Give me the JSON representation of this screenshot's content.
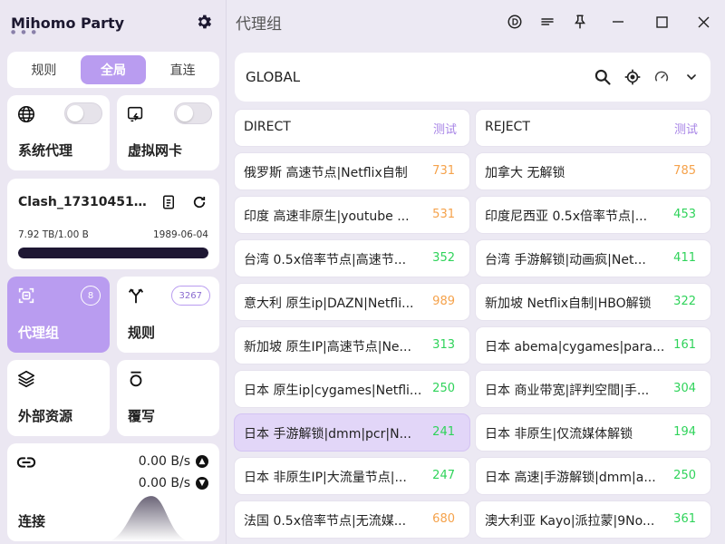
{
  "app": {
    "name": "Mihomo Party",
    "page_title": "代理组"
  },
  "mode_switch": {
    "options": [
      "规则",
      "全局",
      "直连"
    ],
    "active": "全局"
  },
  "sidebar": {
    "system_proxy": {
      "label": "系统代理",
      "enabled": false
    },
    "tun": {
      "label": "虚拟网卡",
      "enabled": false
    },
    "profile": {
      "name": "Clash_1731045177....",
      "usage": "7.92 TB/1.00 B",
      "expire": "1989-06-04",
      "usage_fill_percent": 100
    },
    "proxy_groups": {
      "label": "代理组",
      "count": "8"
    },
    "rules": {
      "label": "规则",
      "count": "3267"
    },
    "external_resources": {
      "label": "外部资源"
    },
    "override": {
      "label": "覆写"
    },
    "connections": {
      "label": "连接",
      "upload": "0.00 B/s",
      "download": "0.00 B/s"
    }
  },
  "group": {
    "name": "GLOBAL"
  },
  "test_label": "测试",
  "delay_colors": {
    "good": "#2fd35a",
    "slow": "#f5a24b"
  },
  "proxies": [
    {
      "name": "DIRECT",
      "delay": "",
      "head": true
    },
    {
      "name": "REJECT",
      "delay": "",
      "head": true
    },
    {
      "name": "俄罗斯 高速节点|Netflix自制",
      "delay": "731",
      "level": "slow"
    },
    {
      "name": "加拿大 无解锁",
      "delay": "785",
      "level": "slow"
    },
    {
      "name": "印度 高速非原生|youtube ...",
      "delay": "531",
      "level": "slow"
    },
    {
      "name": "印度尼西亚 0.5x倍率节点|...",
      "delay": "453",
      "level": "good"
    },
    {
      "name": "台湾 0.5x倍率节点|高速节...",
      "delay": "352",
      "level": "good"
    },
    {
      "name": "台湾 手游解锁|动画疯|Net...",
      "delay": "411",
      "level": "good"
    },
    {
      "name": "意大利 原生ip|DAZN|Netfli...",
      "delay": "989",
      "level": "slow"
    },
    {
      "name": "新加坡 Netflix自制|HBO解锁",
      "delay": "322",
      "level": "good"
    },
    {
      "name": "新加坡 原生IP|高速节点|Ne...",
      "delay": "313",
      "level": "good"
    },
    {
      "name": "日本 abema|cygames|para...",
      "delay": "161",
      "level": "good"
    },
    {
      "name": "日本 原生ip|cygames|Netfli...",
      "delay": "250",
      "level": "good"
    },
    {
      "name": "日本 商业带宽|評判空間|手...",
      "delay": "304",
      "level": "good"
    },
    {
      "name": "日本 手游解锁|dmm|pcr|N...",
      "delay": "241",
      "level": "good",
      "selected": true
    },
    {
      "name": "日本 非原生|仅流媒体解锁",
      "delay": "194",
      "level": "good"
    },
    {
      "name": "日本 非原生IP|大流量节点|...",
      "delay": "247",
      "level": "good"
    },
    {
      "name": "日本 高速|手游解锁|dmm|a...",
      "delay": "250",
      "level": "good"
    },
    {
      "name": "法国 0.5x倍率节点|无流媒...",
      "delay": "680",
      "level": "slow"
    },
    {
      "name": "澳大利亚 Kayo|派拉蒙|9No...",
      "delay": "361",
      "level": "good"
    }
  ]
}
